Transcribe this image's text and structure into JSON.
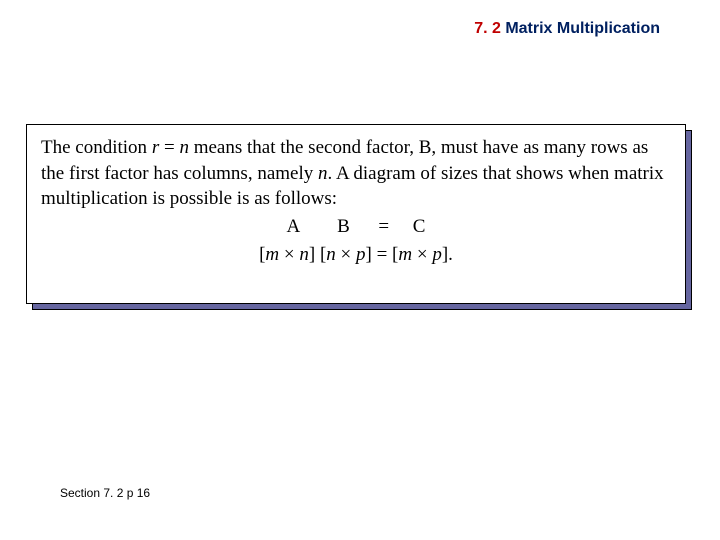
{
  "header": {
    "section_num": "7. 2",
    "title": "Matrix Multiplication"
  },
  "body": {
    "p1a": "The condition ",
    "p1_r": "r",
    "p1b": " = ",
    "p1_n": "n",
    "p1c": " means that the second factor, B, must have as many rows as the first factor has columns, namely ",
    "p1_n2": "n",
    "p1d": ". A diagram of sizes that shows when matrix multiplication is possible is as follows:",
    "eq1": "A        B      =     C",
    "eq2_a": "[",
    "eq2_m": "m",
    "eq2_b": " × ",
    "eq2_n": "n",
    "eq2_c": "]  [",
    "eq2_n2": "n",
    "eq2_d": " × ",
    "eq2_p": "p",
    "eq2_e": "] = [",
    "eq2_m2": "m",
    "eq2_f": " × ",
    "eq2_p2": "p",
    "eq2_g": "]."
  },
  "footer": {
    "label": "Section 7. 2  p 16"
  }
}
